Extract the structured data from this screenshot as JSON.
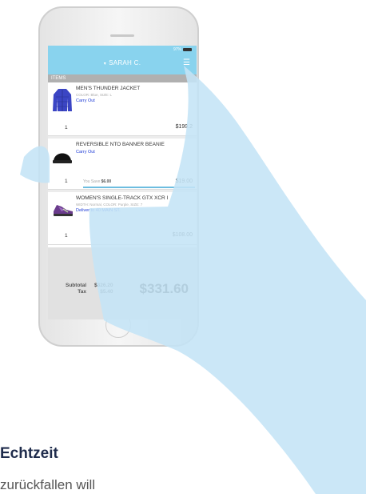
{
  "status_bar": {
    "battery": "97%"
  },
  "header": {
    "customer": "SARAH C."
  },
  "section_label": "ITEMS",
  "items": [
    {
      "name": "MEN'S THUNDER JACKET",
      "meta": "COLOR: Blue, SIZE: L",
      "fulfillment": "Carry Out",
      "qty": "1",
      "price": "$199.2"
    },
    {
      "name": "REVERSIBLE NTO BANNER BEANIE",
      "meta": "",
      "fulfillment": "Carry Out",
      "qty": "1",
      "savings_label": "You Save",
      "savings_amount": "$6.00",
      "price": "$19.00"
    },
    {
      "name": "WOMEN'S SINGLE-TRACK GTX XCR I",
      "meta": "WIDTH: Normal, COLOR: Purple, SIZE: 7",
      "fulfillment": "Deliver to 40 MAIN ST.",
      "qty": "1",
      "price": "$108.00"
    }
  ],
  "totals": {
    "subtotal_label": "Subtotal",
    "tax_label": "Tax",
    "subtotal": "$326.20",
    "tax": "$5.40",
    "grand_total": "$331.60"
  },
  "page": {
    "heading": "Echtzeit",
    "body": "zurückfallen will"
  },
  "colors": {
    "accent": "#89d3ee",
    "hand": "#c4e4f6",
    "link": "#1e3bd6",
    "heading": "#1f2c4c"
  }
}
